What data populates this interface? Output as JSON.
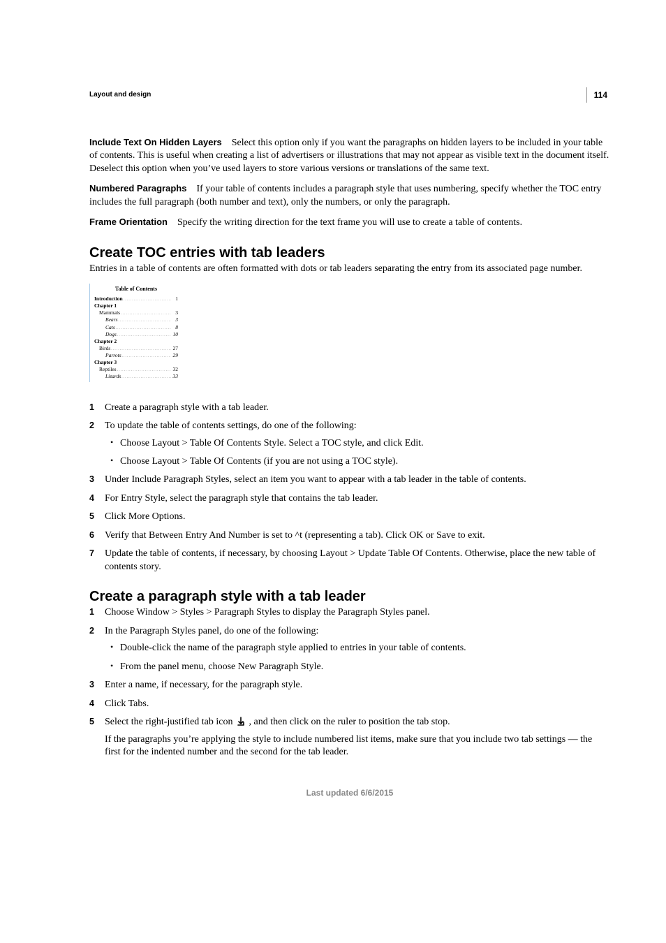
{
  "meta": {
    "page_number": "114",
    "chapter": "Layout and design",
    "footer": "Last updated 6/6/2015"
  },
  "defs": [
    {
      "term": "Include Text On Hidden Layers",
      "body": "Select this option only if you want the paragraphs on hidden layers to be included in your table of contents. This is useful when creating a list of advertisers or illustrations that may not appear as visible text in the document itself. Deselect this option when you’ve used layers to store various versions or translations of the same text."
    },
    {
      "term": "Numbered Paragraphs",
      "body": "If your table of contents includes a paragraph style that uses numbering, specify whether the TOC entry includes the full paragraph (both number and text), only the numbers, or only the paragraph."
    },
    {
      "term": "Frame Orientation",
      "body": "Specify the writing direction for the text frame you will use to create a table of contents."
    }
  ],
  "sec1": {
    "heading": "Create TOC entries with tab leaders",
    "intro": "Entries in a table of contents are often formatted with dots or tab leaders separating the entry from its associated page number.",
    "figure": {
      "title": "Table of Contents",
      "rows": [
        {
          "label": "Introduction",
          "page": "1",
          "indent": 0,
          "bold": true
        },
        {
          "label": "Chapter 1",
          "page": "",
          "indent": 0,
          "bold": true
        },
        {
          "label": "Mammals",
          "page": "3",
          "indent": 1,
          "bold": false
        },
        {
          "label": "Bears",
          "page": "3",
          "indent": 2,
          "bold": false
        },
        {
          "label": "Cats",
          "page": "8",
          "indent": 2,
          "bold": false
        },
        {
          "label": "Dogs",
          "page": "10",
          "indent": 2,
          "bold": false
        },
        {
          "label": "Chapter 2",
          "page": "",
          "indent": 0,
          "bold": true
        },
        {
          "label": "Birds",
          "page": "27",
          "indent": 1,
          "bold": false
        },
        {
          "label": "Parrots",
          "page": "29",
          "indent": 2,
          "bold": false
        },
        {
          "label": "Chapter 3",
          "page": "",
          "indent": 0,
          "bold": true
        },
        {
          "label": "Reptiles",
          "page": "32",
          "indent": 1,
          "bold": false
        },
        {
          "label": "Lizards",
          "page": "33",
          "indent": 2,
          "bold": false
        }
      ]
    },
    "steps": [
      "Create a paragraph style with a tab leader.",
      "To update the table of contents settings, do one of the following:",
      "Under Include Paragraph Styles, select an item you want to appear with a tab leader in the table of contents.",
      "For Entry Style, select the paragraph style that contains the tab leader.",
      "Click More Options.",
      "Verify that Between Entry And Number is set to ^t (representing a tab). Click OK or Save to exit.",
      "Update the table of contents, if necessary, by choosing Layout > Update Table Of Contents. Otherwise, place the new table of contents story."
    ],
    "step2_bullets": [
      "Choose Layout > Table Of Contents Style. Select a TOC style, and click Edit.",
      "Choose Layout > Table Of Contents (if you are not using a TOC style)."
    ]
  },
  "sec2": {
    "heading": "Create a paragraph style with a tab leader",
    "steps": [
      "Choose Window > Styles > Paragraph Styles to display the Paragraph Styles panel.",
      "In the Paragraph Styles panel, do one of the following:",
      "Enter a name, if necessary, for the paragraph style.",
      "Click Tabs."
    ],
    "step2_bullets": [
      "Double-click the name of the paragraph style applied to entries in your table of contents.",
      "From the panel menu, choose New Paragraph Style."
    ],
    "step5_a": "Select the right-justified tab icon ",
    "step5_b": " , and then click on the ruler to position the tab stop.",
    "step5_follow": "If the paragraphs you’re applying the style to include numbered list items, make sure that you include two tab settings — the first for the indented number and the second for the tab leader."
  }
}
